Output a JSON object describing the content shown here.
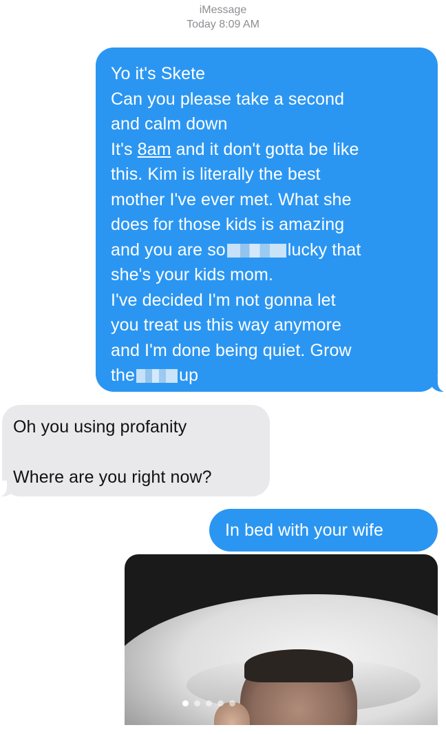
{
  "header": {
    "service": "iMessage",
    "day": "Today",
    "time": "8:09 AM"
  },
  "messages": [
    {
      "direction": "sent",
      "lines": [
        "Yo it's Skete",
        "Can you please take a second",
        "and calm down",
        "It's",
        "8am",
        "and it don't gotta be like",
        "this. Kim is literally the best",
        "mother I've ever met. What she",
        "does for those kids is amazing",
        "and you are so",
        "lucky that",
        "she's your kids mom.",
        "I've decided I'm not gonna let",
        "you treat us this way anymore",
        "and I'm done being quiet. Grow",
        "the",
        "up"
      ]
    },
    {
      "direction": "received",
      "lines": [
        "Oh you using profanity",
        "Where are you right now?"
      ]
    },
    {
      "direction": "sent",
      "text": "In bed with your wife"
    }
  ],
  "photo": {
    "alt": "selfie in bed",
    "page_dots": 5,
    "active_dot": 0
  },
  "colors": {
    "sent_bubble": "#2b96f2",
    "received_bubble": "#e9e9eb",
    "meta_text": "#8e8e93"
  }
}
